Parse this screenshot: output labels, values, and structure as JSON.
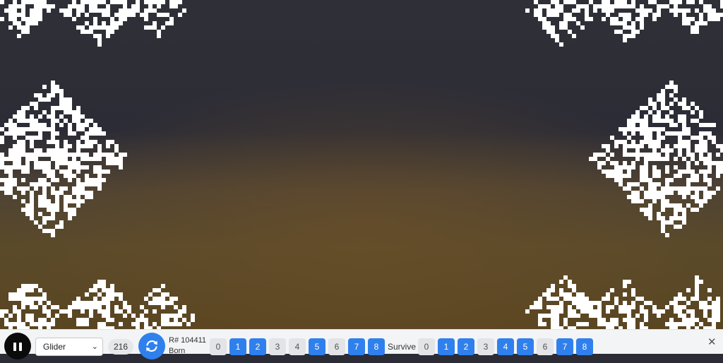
{
  "toolbar": {
    "pattern_select": "Glider",
    "generation": "216",
    "seed": "R# 104411",
    "born_label": "Born",
    "survive_label": "Survive",
    "close_glyph": "✕"
  },
  "rules": {
    "born": [
      {
        "label": "0",
        "on": false
      },
      {
        "label": "1",
        "on": true
      },
      {
        "label": "2",
        "on": true
      },
      {
        "label": "3",
        "on": false
      },
      {
        "label": "4",
        "on": false
      },
      {
        "label": "5",
        "on": true
      },
      {
        "label": "6",
        "on": false
      },
      {
        "label": "7",
        "on": true
      },
      {
        "label": "8",
        "on": true
      }
    ],
    "survive": [
      {
        "label": "0",
        "on": false
      },
      {
        "label": "1",
        "on": true
      },
      {
        "label": "2",
        "on": true
      },
      {
        "label": "3",
        "on": false
      },
      {
        "label": "4",
        "on": true
      },
      {
        "label": "5",
        "on": true
      },
      {
        "label": "6",
        "on": false
      },
      {
        "label": "7",
        "on": true
      },
      {
        "label": "8",
        "on": true
      }
    ]
  },
  "colors": {
    "accent": "#2f80ed",
    "cell": "#ffffff",
    "toolbar_bg": "#f3f4f6"
  },
  "icons": {
    "play_pause": "pause-icon",
    "reseed": "refresh-icon",
    "close": "close-icon"
  }
}
